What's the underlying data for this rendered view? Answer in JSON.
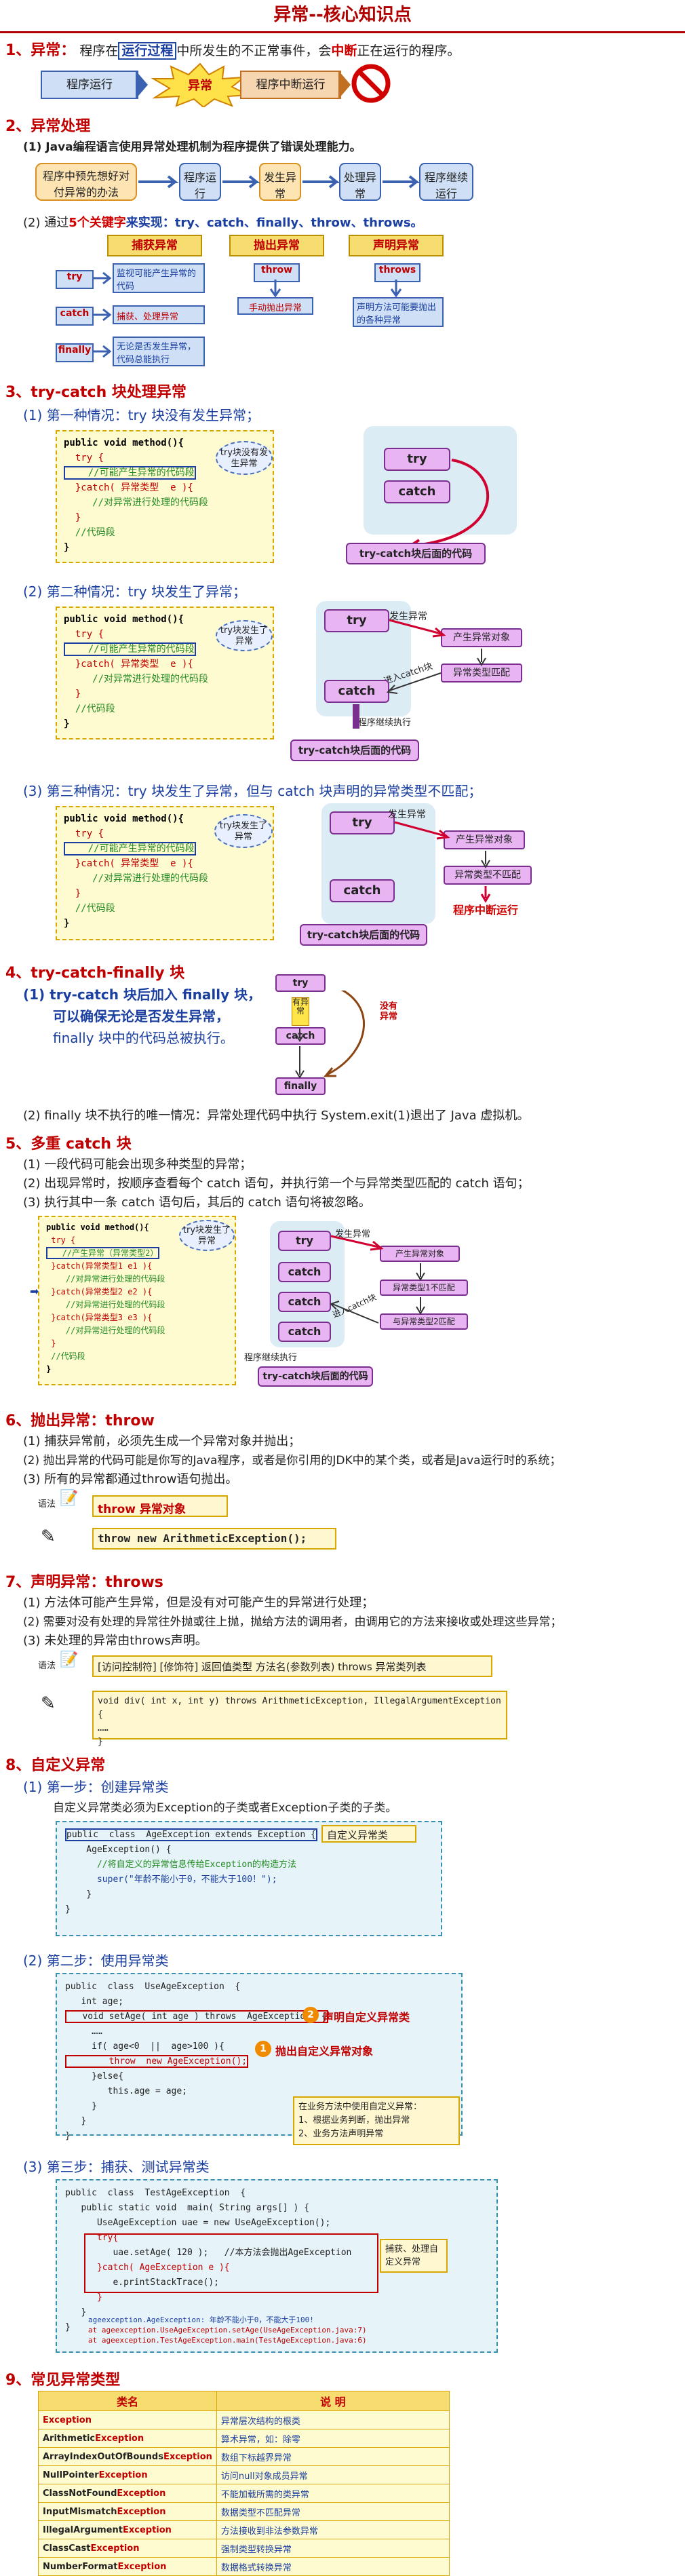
{
  "title": "异常--核心知识点",
  "s1": {
    "head": "1、异常：",
    "text_pre": "程序在",
    "text_box": "运行过程",
    "text_mid": "中所发生的不正常事件，会",
    "text_red": "中断",
    "text_post": "正在运行的程序。",
    "flow": [
      "程序运行",
      "异常",
      "程序中断运行"
    ]
  },
  "s2": {
    "head": "2、异常处理",
    "line1": "(1) Java编程语言使用异常处理机制为程序提供了错误处理能力。",
    "flow": [
      "程序中预先想好对付异常的办法",
      "程序运行",
      "发生异常",
      "处理异常",
      "程序继续运行"
    ],
    "line2_pre": "(2) 通过",
    "line2_num": "5个关键字",
    "line2_post": "来实现：try、catch、finally、throw、throws。",
    "cats": [
      "捕获异常",
      "抛出异常",
      "声明异常"
    ],
    "kw": [
      {
        "k": "try",
        "d": "监视可能产生异常的代码"
      },
      {
        "k": "catch",
        "d": "捕获、处理异常"
      },
      {
        "k": "finally",
        "d": "无论是否发生异常，代码总能执行"
      }
    ],
    "throw": {
      "k": "throw",
      "d": "手动抛出异常"
    },
    "throws": {
      "k": "throws",
      "d": "声明方法可能要抛出的各种异常"
    }
  },
  "s3": {
    "head": "3、try-catch 块处理异常",
    "case1": "(1) 第一种情况：try 块没有发生异常；",
    "case2": "(2) 第二种情况：try 块发生了异常；",
    "case3": "(3) 第三种情况：try 块发生了异常，但与 catch 块声明的异常类型不匹配；",
    "code_lines": [
      "public void method(){",
      "  try {",
      "    //可能产生异常的代码段",
      "  }catch( 异常类型  e ){",
      "     //对异常进行处理的代码段",
      "  }",
      "  //代码段",
      "}"
    ],
    "cloud1": "try块没有发生异常",
    "cloud2": "try块发生了异常",
    "try": "try",
    "catch": "catch",
    "after": "try-catch块后面的代码",
    "occur": "发生异常",
    "produce": "产生异常对象",
    "match": "异常类型匹配",
    "into_catch": "进入catch块",
    "continue": "程序继续执行",
    "nomatch": "异常类型不匹配",
    "interrupt": "程序中断运行"
  },
  "s4": {
    "head": "4、try-catch-finally 块",
    "l1": "(1) try-catch 块后加入 finally 块，",
    "l2": "可以确保无论是否发生异常，",
    "l3": "finally 块中的代码总被执行。",
    "l4": "(2) finally 块不执行的唯一情况：异常处理代码中执行 System.exit(1)退出了 Java 虚拟机。",
    "have": "有异常",
    "none": "没有异常",
    "finally": "finally"
  },
  "s5": {
    "head": "5、多重 catch 块",
    "l1": "(1) 一段代码可能会出现多种类型的异常；",
    "l2": "(2) 出现异常时，按顺序查看每个 catch 语句，并执行第一个与异常类型匹配的 catch 语句；",
    "l3": "(3) 执行其中一条 catch 语句后，其后的 catch 语句将被忽略。",
    "code_lines": [
      "public void method(){",
      " try {",
      "   //产生异常（异常类型2）",
      " }catch(异常类型1 e1 ){",
      "    //对异常进行处理的代码段",
      " }catch(异常类型2 e2 ){",
      "    //对异常进行处理的代码段",
      " }catch(异常类型3 e3 ){",
      "    //对异常进行处理的代码段",
      " }",
      " //代码段",
      "}"
    ],
    "cloud": "try块发生了异常",
    "m1": "异常类型1不匹配",
    "m2": "与异常类型2匹配"
  },
  "s6": {
    "head": "6、抛出异常：throw",
    "l1": "(1) 捕获异常前，必须先生成一个异常对象并抛出；",
    "l2": "(2) 抛出异常的代码可能是你写的Java程序，或者是你引用的JDK中的某个类，或者是Java运行时的系统；",
    "l3": "(3) 所有的异常都通过throw语句抛出。",
    "grammar": "语法",
    "g1": "throw   异常对象",
    "g2": "throw  new  ArithmeticException();"
  },
  "s7": {
    "head": "7、声明异常：throws",
    "l1": "(1) 方法体可能产生异常，但是没有对可能产生的异常进行处理；",
    "l2": "(2) 需要对没有处理的异常往外抛或往上抛，抛给方法的调用者，由调用它的方法来接收或处理这些异常；",
    "l3": "(3) 未处理的异常由throws声明。",
    "grammar": "语法",
    "g1": "[访问控制符] [修饰符]  返回值类型 方法名(参数列表) throws  异常类列表",
    "g2a": "void div( int x, int y) throws ArithmeticException, IllegalArgumentException {",
    "g2b": "   ……",
    "g2c": "}"
  },
  "s8": {
    "head": "8、自定义异常",
    "step1": "(1) 第一步：创建异常类",
    "step1_desc": "自定义异常类必须为Exception的子类或者Exception子类的子类。",
    "code1": [
      "public  class  AgeException extends Exception {",
      "    AgeException() {",
      "      //将自定义的异常信息传给Exception的构造方法",
      "      super(\"年龄不能小于0，不能大于100！\");",
      "    }",
      "}"
    ],
    "note1": "自定义异常类",
    "step2": "(2) 第二步：使用异常类",
    "code2": [
      "public  class  UseAgeException  {",
      "   int age;",
      "   void setAge( int age ) throws  AgeException  {",
      "     ……",
      "     if( age<0  ||  age>100 ){",
      "        throw  new AgeException();",
      "     }else{",
      "        this.age = age;",
      "     }",
      "   }",
      "}"
    ],
    "n2a_num": "2",
    "n2a": "声明自定义异常类",
    "n2b_num": "1",
    "n2b": "抛出自定义异常对象",
    "n2c1": "在业务方法中使用自定义异常：",
    "n2c2": "1、根据业务判断，抛出异常",
    "n2c3": "2、业务方法声明异常",
    "step3": "(3) 第三步：捕获、测试异常类",
    "code3": [
      "public  class  TestAgeException  {",
      "   public static void  main( String args[] ) {",
      "      UseAgeException uae = new UseAgeException();",
      "      try{",
      "         uae.setAge( 120 );   //本方法会抛出AgeException",
      "      }catch( AgeException e ){",
      "         e.printStackTrace();",
      "      }",
      "   }",
      "}"
    ],
    "n3": "捕获、处理自定义异常",
    "out1": "ageexception.AgeException: 年龄不能小于0，不能大于100!",
    "out2": "      at ageexception.UseAgeException.setAge(UseAgeException.java:7)",
    "out3": "      at ageexception.TestAgeException.main(TestAgeException.java:6)"
  },
  "s9": {
    "head": "9、常见异常类型",
    "col1": "类名",
    "col2": "说  明",
    "rows": [
      [
        "Exception",
        "异常层次结构的根类"
      ],
      [
        "ArithmeticException",
        "算术异常，如：除零"
      ],
      [
        "ArrayIndexOutOfBoundsException",
        "数组下标越界异常"
      ],
      [
        "NullPointerException",
        "访问null对象成员异常"
      ],
      [
        "ClassNotFoundException",
        "不能加载所需的类异常"
      ],
      [
        "InputMismatchException",
        "数据类型不匹配异常"
      ],
      [
        "IllegalArgumentException",
        "方法接收到非法参数异常"
      ],
      [
        "ClassCastException",
        "强制类型转换异常"
      ],
      [
        "NumberFormatException",
        "数据格式转换异常"
      ]
    ]
  },
  "colors": {
    "accent": "#c00000",
    "blue": "#1a3fa0",
    "pill": "#e9b4f2"
  }
}
